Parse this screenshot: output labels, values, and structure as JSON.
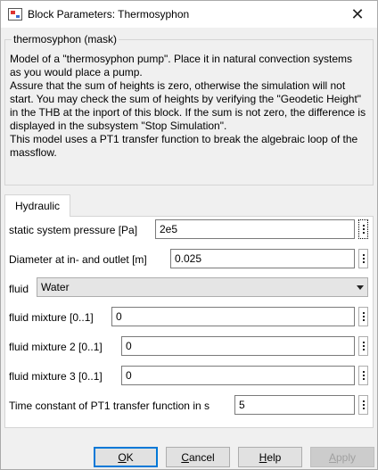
{
  "window": {
    "title": "Block Parameters: Thermosyphon",
    "close_glyph": "✕"
  },
  "mask": {
    "section_label": "thermosyphon (mask)",
    "description": "Model of a \"thermosyphon pump\". Place it in natural convection systems as you would place a pump.\nAssure that the sum of heights is zero, otherwise the simulation will not start. You may check the sum of heights by verifying the \"Geodetic Height\" in the THB at the inport of this block. If the sum is not zero, the difference is displayed in the subsystem \"Stop Simulation\".\nThis model uses a PT1 transfer function to break the algebraic loop of the massflow."
  },
  "tabs": [
    {
      "label": "Hydraulic",
      "active": true
    }
  ],
  "params": {
    "static_pressure": {
      "label": "static system pressure [Pa]",
      "value": "2e5"
    },
    "diameter": {
      "label": "Diameter at in- and outlet [m]",
      "value": "0.025"
    },
    "fluid": {
      "label": "fluid",
      "value": "Water"
    },
    "mixture1": {
      "label": "fluid mixture [0..1]",
      "value": "0"
    },
    "mixture2": {
      "label": "fluid mixture 2 [0..1]",
      "value": "0"
    },
    "mixture3": {
      "label": "fluid mixture 3 [0..1]",
      "value": "0"
    },
    "time_constant": {
      "label": "Time constant of PT1 transfer function in s",
      "value": "5"
    }
  },
  "buttons": {
    "ok": {
      "accel": "O",
      "rest": "K"
    },
    "cancel": {
      "accel": "C",
      "rest": "ancel"
    },
    "help": {
      "accel": "H",
      "rest": "elp"
    },
    "apply": {
      "accel": "A",
      "rest": "pply"
    }
  },
  "icons": {
    "app": "simulink-block-icon",
    "close": "close-icon",
    "dropdown": "chevron-down-icon",
    "more": "ellipsis-vertical-icon"
  }
}
